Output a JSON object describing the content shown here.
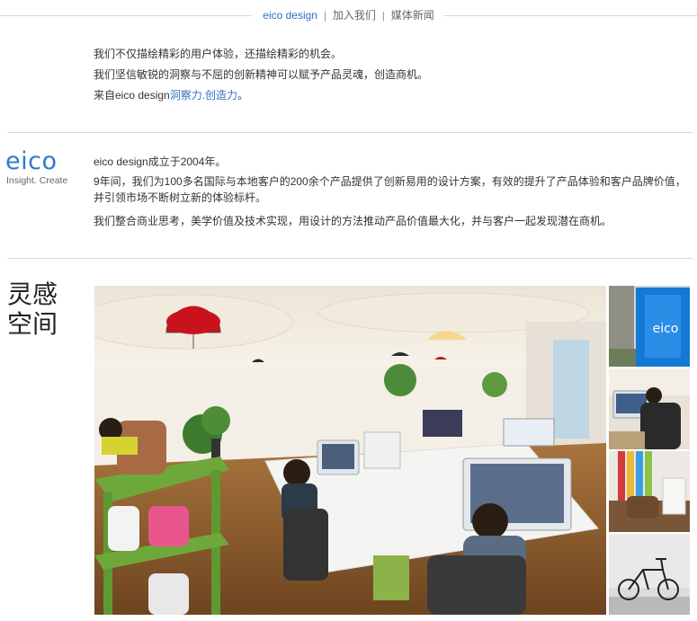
{
  "nav": {
    "brand": "eico design",
    "sep": "|",
    "join": "加入我们",
    "news": "媒体新闻"
  },
  "intro": {
    "line1": "我们不仅描绘精彩的用户体验，还描绘精彩的机会。",
    "line2": "我们坚信敏锐的洞察与不屈的创新精神可以赋予产品灵魂，创造商机。",
    "line3_prefix": "来自eico design",
    "line3_link": "洞察力.创造力",
    "line3_suffix": "。"
  },
  "logo": {
    "word": "eico",
    "tagline": "Insight. Create"
  },
  "about": {
    "p1": "eico design成立于2004年。",
    "p2": "9年间，我们为100多名国际与本地客户的200余个产品提供了创新易用的设计方案，有效的提升了产品体验和客户品牌价值，并引领市场不断树立新的体验标杆。",
    "p3": "我们整合商业思考，美学价值及技术实现，用设计的方法推动产品价值最大化，并与客户一起发现潜在商机。"
  },
  "space": {
    "title_line1": "灵感",
    "title_line2": "空间",
    "thumb1_sign": "eico"
  },
  "colors": {
    "accent": "#2f6fc0",
    "logo_blue": "#2f78cc",
    "rule": "#d8d8d8"
  }
}
